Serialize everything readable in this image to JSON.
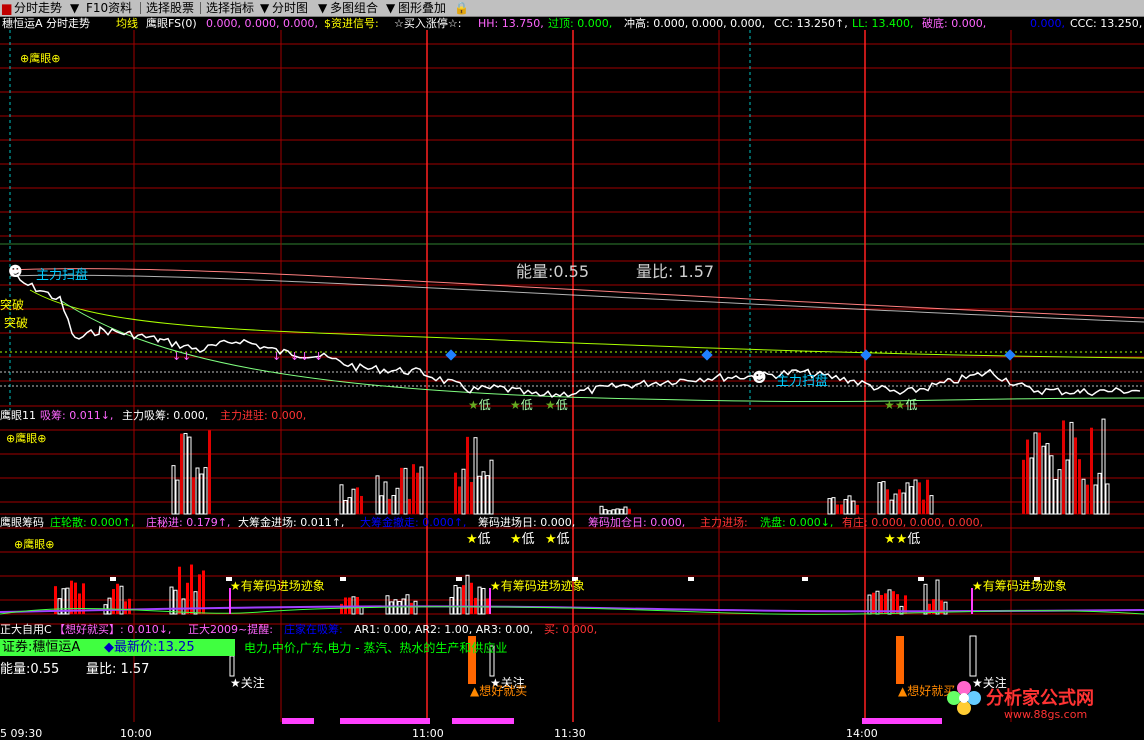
{
  "toolbar": {
    "items": [
      "分时走势",
      "F10资料",
      "选择股票",
      "选择指标",
      "分时图",
      "多图组合",
      "图形叠加"
    ]
  },
  "header": {
    "stock": "穗恒运A 分时走势",
    "avg_label": "均线",
    "indicator": "鹰眼FS(0)",
    "values": "0.000, 0.000, 0.000,",
    "signal": "$资进信号:",
    "signal2": "☆买入涨停☆:",
    "hh": "HH: 13.750,",
    "guoding": "过顶: 0.000,",
    "chonggao": "冲高: 0.000, 0.000, 0.000,",
    "cc": "CC: 13.250↑,",
    "ll": "LL: 13.400,",
    "podi": "破底: 0.000,",
    "podi2": "0.000,",
    "ccc": "CCC: 13.250,"
  },
  "panel1": {
    "logo": "⊕鹰眼⊕",
    "energy": "能量:0.55",
    "volratio": "量比: 1.57",
    "tag_scan1": "主力扫盘",
    "tag_scan2": "主力扫盘",
    "tag_break": "突破",
    "tag_break2": "突破",
    "low": "低"
  },
  "panel2": {
    "label": "鹰眼11",
    "x1": "吸筹: 0.011↓,",
    "x2": "主力吸筹: 0.000,",
    "x3": "主力进驻: 0.000,",
    "logo": "⊕鹰眼⊕"
  },
  "panel3": {
    "label": "鹰眼筹码",
    "a": "庄轮散: 0.000↑,",
    "b": "庄秘进: 0.179↑,",
    "c": "大筹金进场: 0.011↑,",
    "d": "大筹金撤走: 0.000↑,",
    "e": "筹码进场日: 0.000,",
    "f": "筹码加仓日: 0.000,",
    "g": "主力进场:",
    "h": "洗盘: 0.000↓,",
    "i": "有庄: 0.000, 0.000, 0.000,",
    "low": "低"
  },
  "panel4": {
    "logo": "⊕鹰眼⊕",
    "signal": "★有筹码进场迹象"
  },
  "panel5": {
    "label": "正大自用C",
    "a": "【想好就买】: 0.010↓,",
    "b": "正大2009~提醒:",
    "c": "庄家在吸筹:",
    "d": "AR1: 0.00, AR2: 1.00, AR3: 0.00,",
    "e": "买: 0.000,",
    "info": "证券:穗恒运A",
    "price": "◆最新价:13.25",
    "industry": "电力,中价,广东,电力 - 蒸汽、热水的生产和供应业",
    "energy": "能量:0.55",
    "volratio": "量比: 1.57",
    "attention": "★关注",
    "buy": "▲想好就买"
  },
  "axis": {
    "t0": "5 09:30",
    "t1": "10:00",
    "t2": "11:00",
    "t3": "11:30",
    "t4": "14:00"
  },
  "watermark": {
    "text": "分析家公式网",
    "url": "www.88gs.com"
  }
}
